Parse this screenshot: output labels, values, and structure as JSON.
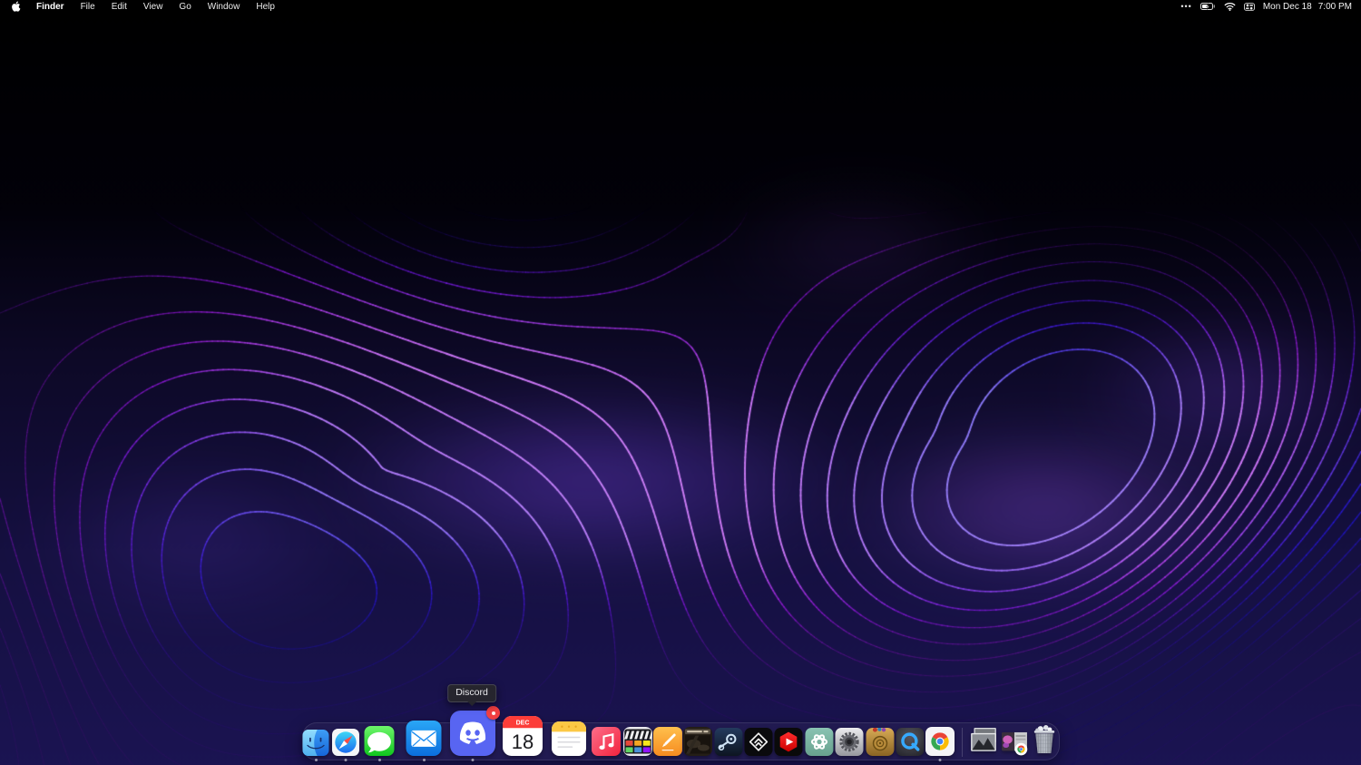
{
  "theme": {
    "wallpaper_accent": "#7b3ff2",
    "wallpaper_magenta": "#b44cf0",
    "wallpaper_bottom": "#1b1452",
    "badge_red": "#f23f42",
    "discord_blurple": "#5865f2"
  },
  "menu_bar": {
    "apple_logo": "apple-icon",
    "active_app": "Finder",
    "menus": [
      "Finder",
      "File",
      "Edit",
      "View",
      "Go",
      "Window",
      "Help"
    ],
    "status": {
      "overflow": "•••",
      "battery_icon": "battery-charging-icon",
      "wifi_icon": "wifi-icon",
      "control_center_icon": "control-center-icon",
      "date": "Mon Dec 18",
      "time": "7:00 PM"
    }
  },
  "tooltip": {
    "text": "Discord"
  },
  "dock": {
    "apps": [
      {
        "id": "finder",
        "label": "Finder",
        "running": true
      },
      {
        "id": "safari",
        "label": "Safari",
        "running": true
      },
      {
        "id": "messages",
        "label": "Messages",
        "running": true
      },
      {
        "id": "mail",
        "label": "Mail",
        "running": true
      },
      {
        "id": "discord",
        "label": "Discord",
        "running": true,
        "badge": true
      },
      {
        "id": "calendar",
        "label": "Calendar",
        "running": false,
        "month": "DEC",
        "day": "18"
      },
      {
        "id": "notes",
        "label": "Notes",
        "running": false
      },
      {
        "id": "music",
        "label": "Music",
        "running": false
      },
      {
        "id": "imovie",
        "label": "iMovie",
        "running": false
      },
      {
        "id": "pages",
        "label": "Pages",
        "running": false
      },
      {
        "id": "game",
        "label": "Game",
        "running": false
      },
      {
        "id": "steam",
        "label": "Steam",
        "running": false
      },
      {
        "id": "emblem",
        "label": "App",
        "running": false
      },
      {
        "id": "ytstudio",
        "label": "YouTube Studio",
        "running": false
      },
      {
        "id": "chatgpt",
        "label": "ChatGPT",
        "running": false
      },
      {
        "id": "settings",
        "label": "System Settings",
        "running": false
      },
      {
        "id": "gold",
        "label": "Game",
        "running": false
      },
      {
        "id": "quicktime",
        "label": "QuickTime Player",
        "running": false
      },
      {
        "id": "chrome",
        "label": "Google Chrome",
        "running": true
      }
    ],
    "minimized": [
      {
        "id": "win1",
        "label": "Minimized window"
      },
      {
        "id": "win2",
        "label": "Minimized Chrome window"
      }
    ],
    "trash": {
      "id": "trash",
      "label": "Trash",
      "full": true
    }
  }
}
